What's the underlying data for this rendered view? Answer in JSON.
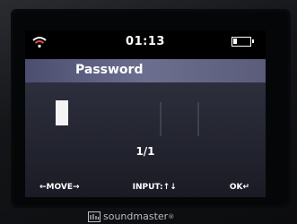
{
  "status_bar": {
    "time": "01:13",
    "wifi_icon": "wifi-icon",
    "battery_icon": "battery-icon",
    "battery_level": 0.25
  },
  "title_bar": {
    "title": "Password"
  },
  "content": {
    "page_indicator": "1/1"
  },
  "hint_bar": {
    "move": "←MOVE→",
    "input": "INPUT:↑↓",
    "ok": "OK↵"
  },
  "brand": {
    "name": "soundmaster",
    "registered": "®"
  },
  "colors": {
    "title_bar": "#5a5d7d",
    "wifi_accent": "#e84a4a",
    "text": "#ffffff"
  }
}
